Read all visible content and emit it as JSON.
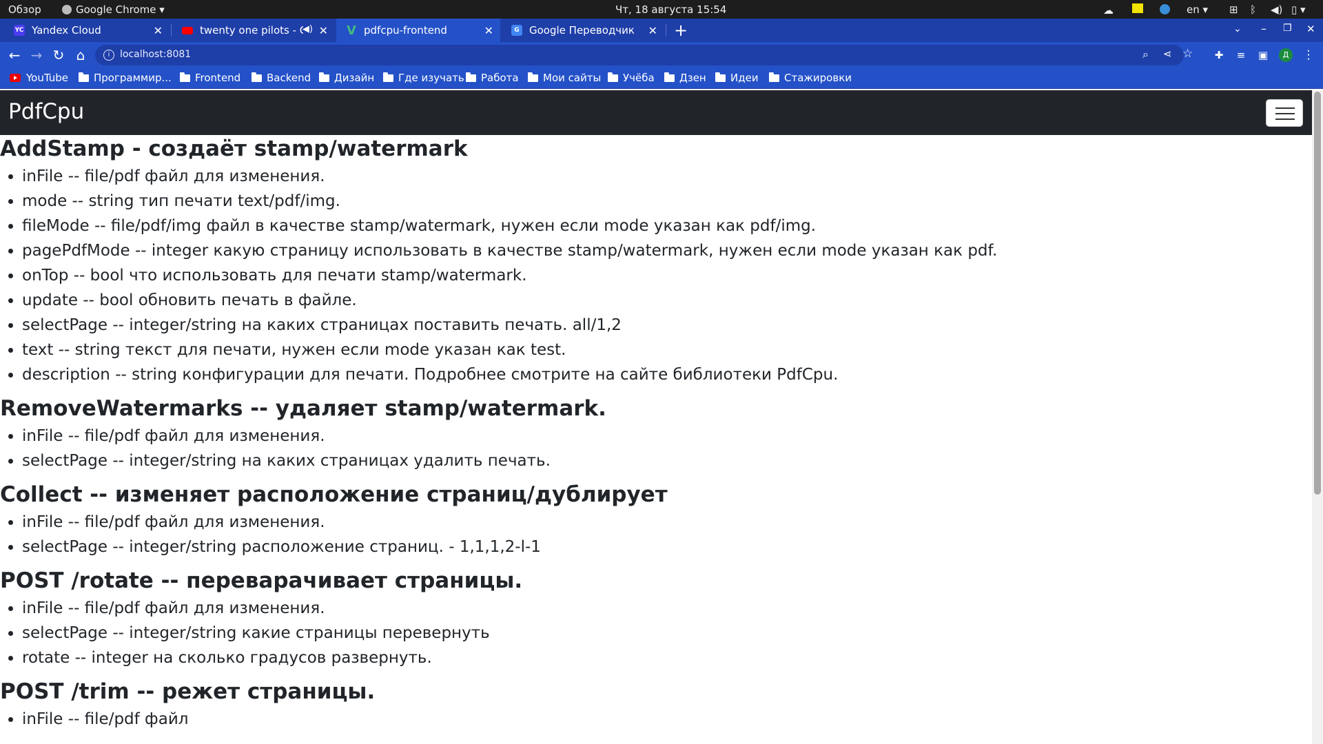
{
  "system_bar": {
    "overview": "Обзор",
    "app_name": "Google Chrome",
    "datetime": "Чт, 18 августа  15:54",
    "lang": "en"
  },
  "tabs": [
    {
      "title": "Yandex Cloud",
      "favicon": "YC",
      "favicon_color": "#4b3cf0"
    },
    {
      "title": "twenty one pilots - Chl",
      "favicon": "youtube-icon",
      "favicon_color": "#ff0000"
    },
    {
      "title": "pdfcpu-frontend",
      "favicon": "vue-icon",
      "favicon_color": "#41b883"
    },
    {
      "title": "Google Переводчик",
      "favicon": "translate-icon",
      "favicon_color": "#4285f4"
    }
  ],
  "address": {
    "url": "localhost:8081"
  },
  "bookmarks": [
    "YouTube",
    "Программир...",
    "Frontend",
    "Backend",
    "Дизайн",
    "Где изучать",
    "Работа",
    "Мои сайты",
    "Учёба",
    "Дзен",
    "Идеи",
    "Стажировки"
  ],
  "navbar": {
    "brand": "PdfCpu"
  },
  "sections": [
    {
      "title": "AddStamp - создаёт stamp/watermark",
      "items": [
        "inFile -- file/pdf файл для изменения.",
        "mode -- string тип печати text/pdf/img.",
        "fileMode -- file/pdf/img файл в качестве stamp/watermark, нужен если mode указан как pdf/img.",
        "pagePdfMode -- integer какую страницу использовать в качестве stamp/watermark, нужен если mode указан как pdf.",
        "onTop -- bool что использовать для печати stamp/watermark.",
        "update -- bool обновить печать в файле.",
        "selectPage -- integer/string на каких страницах поставить печать. all/1,2",
        "text -- string текст для печати, нужен если mode указан как test.",
        "description -- string конфигурации для печати. Подробнее смотрите на сайте библиотеки PdfCpu."
      ]
    },
    {
      "title": "RemoveWatermarks -- удаляет stamp/watermark.",
      "items": [
        "inFile -- file/pdf файл для изменения.",
        "selectPage -- integer/string на каких страницах удалить печать."
      ]
    },
    {
      "title": "Collect -- изменяет расположение страниц/дублирует",
      "items": [
        "inFile -- file/pdf файл для изменения.",
        "selectPage -- integer/string расположение страниц. - 1,1,1,2-l-1"
      ]
    },
    {
      "title": "POST /rotate -- переварачивает страницы.",
      "items": [
        "inFile -- file/pdf файл для изменения.",
        "selectPage -- integer/string какие страницы перевернуть",
        "rotate -- integer на сколько градусов развернуть."
      ]
    },
    {
      "title": "POST /trim -- режет страницы.",
      "items": [
        "inFile -- file/pdf файл"
      ]
    }
  ]
}
